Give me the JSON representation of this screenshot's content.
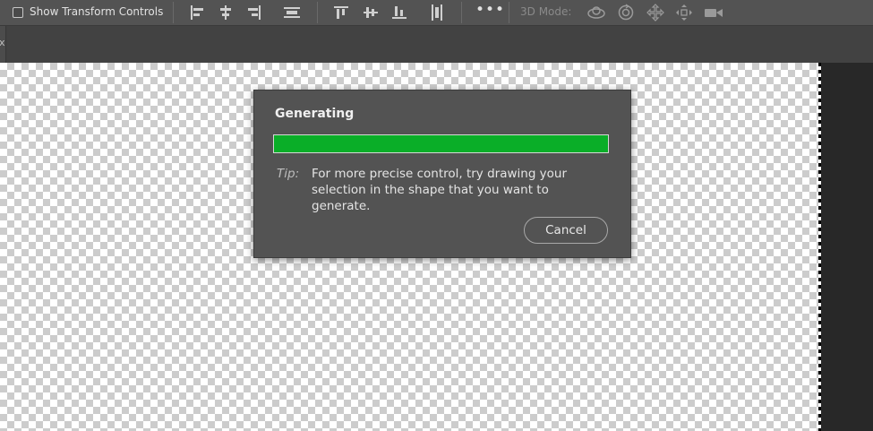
{
  "options_bar": {
    "show_transform_controls": {
      "label": "Show Transform Controls",
      "checked": false
    },
    "align_icons": [
      "align-left-edges-icon",
      "align-horizontal-centers-icon",
      "align-right-edges-icon",
      "distribute-horizontal-icon",
      "align-top-edges-icon",
      "align-vertical-centers-icon",
      "align-bottom-edges-icon",
      "distribute-vertical-icon"
    ],
    "more_label": "•••",
    "mode_label": "3D Mode:",
    "mode_icons": [
      "3d-orbit-icon",
      "3d-roll-icon",
      "3d-pan-icon",
      "3d-slide-icon",
      "3d-camera-icon"
    ]
  },
  "tabstrip": {
    "edge_glyph": "x"
  },
  "dialog": {
    "title": "Generating",
    "progress": 1.0,
    "progress_color": "#0aae28",
    "tip_label": "Tip:",
    "tip_text": "For more precise control, try drawing your selection in the shape that you want to generate.",
    "cancel_label": "Cancel"
  }
}
